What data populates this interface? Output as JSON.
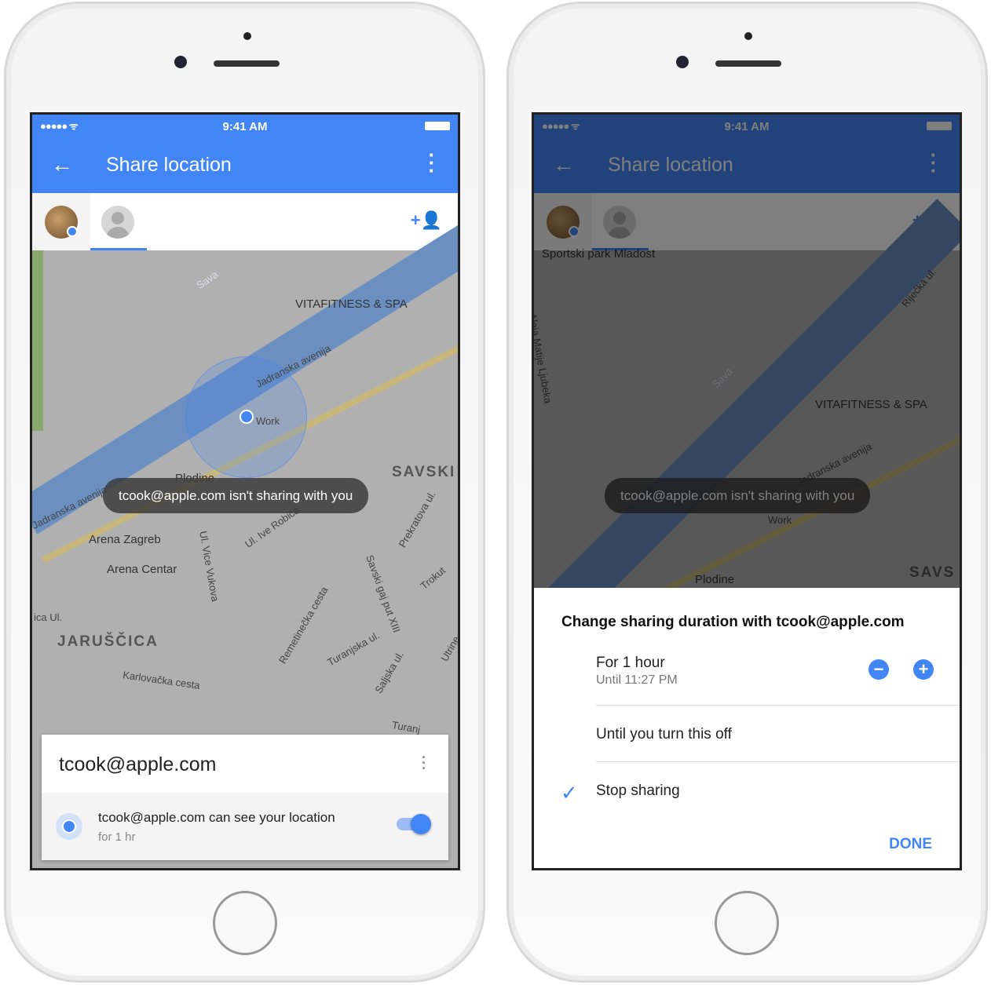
{
  "status": {
    "time": "9:41 AM",
    "signal": "●●●●● ᯤ"
  },
  "appbar": {
    "title": "Share location",
    "back_icon": "←",
    "more_icon": "⋮"
  },
  "tabs": {
    "add_person_icon": "+👤"
  },
  "left": {
    "map_labels": [
      "Sava",
      "VITAFITNESS & SPA",
      "Jadranska avenija",
      "Work",
      "SAVSKI",
      "Plodine",
      "Jadranska avenija",
      "Arena Zagreb",
      "Arena Centar",
      "Ul. Vice Vukova",
      "Ul. Ive Robića",
      "Remetinečka cesta",
      "Savski gaj put XIII",
      "Prekratova ul.",
      "Trokut",
      "JARUŠČICA",
      "Karlovačka cesta",
      "Turanjska ul.",
      "Saljska ul.",
      "Utrine",
      "Turanj",
      "ica Ul."
    ],
    "toast": "tcook@apple.com isn't sharing with you",
    "card": {
      "email": "tcook@apple.com",
      "line1": "tcook@apple.com can see your location",
      "line2": "for 1 hr",
      "toggle_on": true
    }
  },
  "right": {
    "map_labels": [
      "Sportski park Mladost",
      "Aleja Matije Ljubeka",
      "Sava",
      "Rijećka ul.",
      "VITAFITNESS & SPA",
      "Jadranska avenija",
      "Work",
      "Plodine",
      "SAVS"
    ],
    "toast": "tcook@apple.com isn't sharing with you",
    "sheet": {
      "title": "Change sharing duration with tcook@apple.com",
      "option1": "For 1 hour",
      "option1_sub": "Until 11:27 PM",
      "minus": "−",
      "plus": "+",
      "option2": "Until you turn this off",
      "option3": "Stop sharing",
      "selected": "Stop sharing",
      "check_icon": "✓",
      "done": "DONE"
    }
  },
  "colors": {
    "primary": "#4285f4",
    "dark_primary": "#1f3f7a"
  }
}
